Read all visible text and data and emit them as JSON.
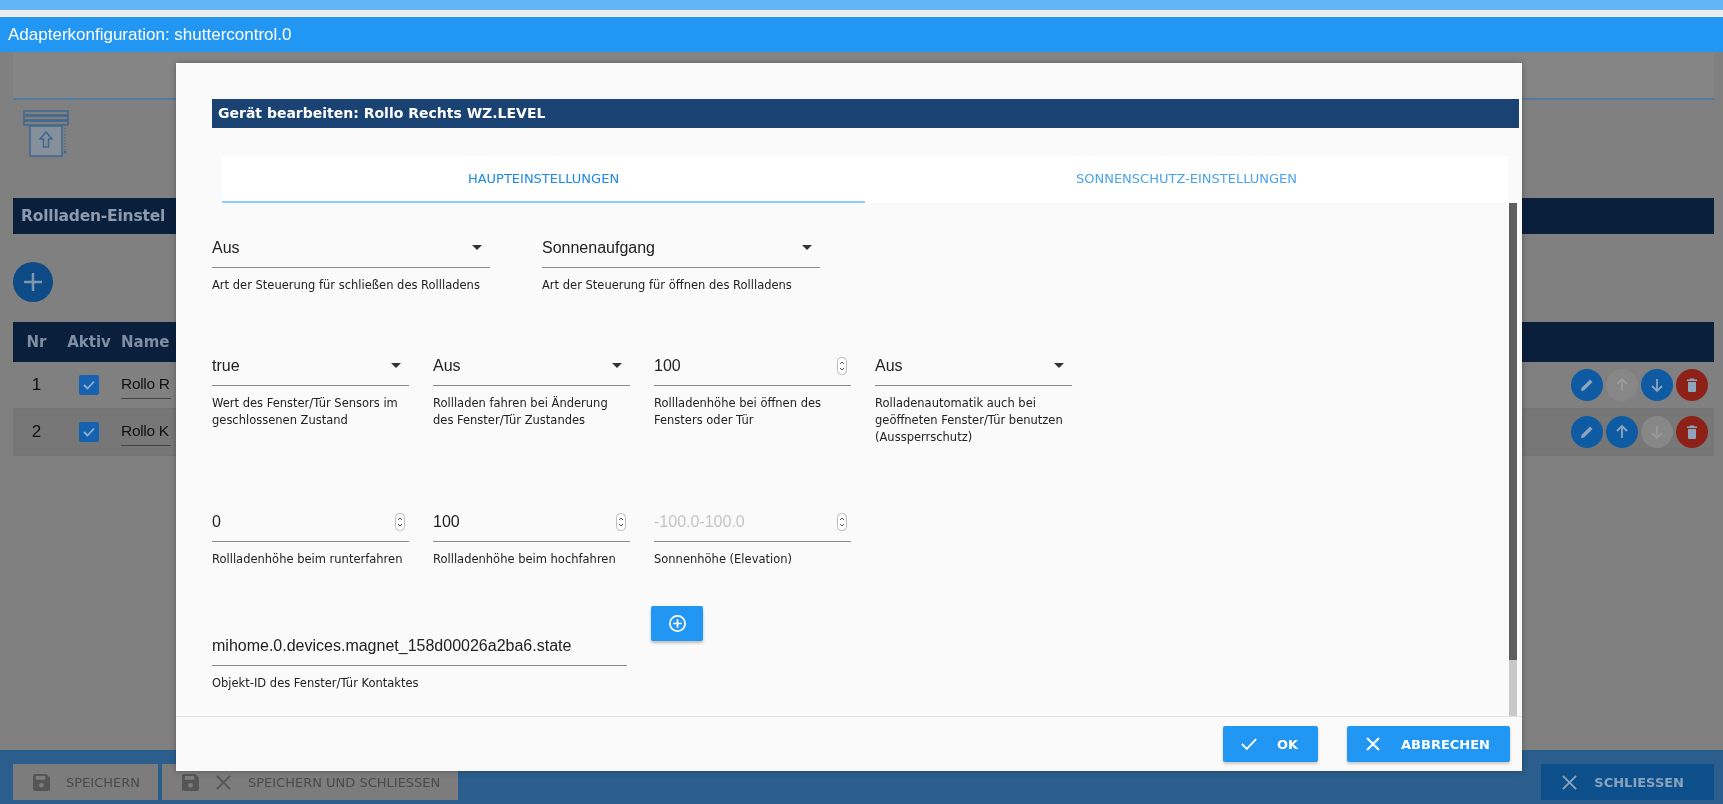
{
  "window": {
    "title": "Adapterkonfiguration: shuttercontrol.0"
  },
  "background": {
    "section_title": "Rollladen-Einstel",
    "table": {
      "columns": [
        "Nr",
        "Aktiv",
        "Name"
      ],
      "rows": [
        {
          "nr": "1",
          "active": true,
          "name": "Rollo R",
          "actions": [
            {
              "kind": "edit",
              "disabled": false
            },
            {
              "kind": "up",
              "disabled": true
            },
            {
              "kind": "down",
              "disabled": false
            },
            {
              "kind": "delete",
              "disabled": false
            }
          ]
        },
        {
          "nr": "2",
          "active": true,
          "name": "Rollo K",
          "actions": [
            {
              "kind": "edit",
              "disabled": false
            },
            {
              "kind": "up",
              "disabled": false
            },
            {
              "kind": "down",
              "disabled": true
            },
            {
              "kind": "delete",
              "disabled": false
            }
          ]
        }
      ]
    },
    "footer_buttons": [
      {
        "kind": "save",
        "label": "SPEICHERN"
      },
      {
        "kind": "save_close",
        "label": "SPEICHERN UND SCHLIESSEN"
      },
      {
        "kind": "close",
        "label": "SCHLIESSEN"
      }
    ]
  },
  "dialog": {
    "title": "Gerät bearbeiten: Rollo Rechts WZ.LEVEL",
    "tabs": [
      {
        "label": "HAUPTEINSTELLUNGEN",
        "selected": true
      },
      {
        "label": "SONNENSCHUTZ-EINSTELLUNGEN",
        "selected": false
      }
    ],
    "rows": [
      [
        {
          "kind": "select",
          "value": "Aus",
          "helper": "Art der Steuerung für schließen des Rollladens"
        },
        {
          "kind": "select",
          "value": "Sonnenaufgang",
          "helper": "Art der Steuerung für öffnen des Rollladens"
        }
      ],
      [
        {
          "kind": "select",
          "value": "true",
          "helper": "Wert des Fenster/Tür Sensors im geschlossenen Zustand"
        },
        {
          "kind": "select",
          "value": "Aus",
          "helper": "Rollladen fahren bei Änderung des Fenster/Tür Zustandes"
        },
        {
          "kind": "number",
          "value": "100",
          "helper": "Rollladenhöhe bei öffnen des Fensters oder Tür"
        },
        {
          "kind": "select",
          "value": "Aus",
          "helper": "Rolladenautomatik auch bei geöffneten Fenster/Tür benutzen (Aussperrschutz)"
        }
      ],
      [
        {
          "kind": "number",
          "value": "0",
          "helper": "Rollladenhöhe beim runterfahren"
        },
        {
          "kind": "number",
          "value": "100",
          "helper": "Rollladenhöhe beim hochfahren"
        },
        {
          "kind": "number",
          "placeholder": "-100.0-100.0",
          "helper": "Sonnenhöhe (Elevation)"
        }
      ],
      [
        {
          "kind": "text",
          "value": "mihome.0.devices.magnet_158d00026a2ba6.state",
          "helper": "Objekt-ID des Fenster/Tür Kontaktes"
        },
        {
          "kind": "add"
        }
      ]
    ],
    "buttons": [
      {
        "kind": "ok",
        "label": "OK"
      },
      {
        "kind": "cancel",
        "label": "ABBRECHEN"
      }
    ]
  }
}
